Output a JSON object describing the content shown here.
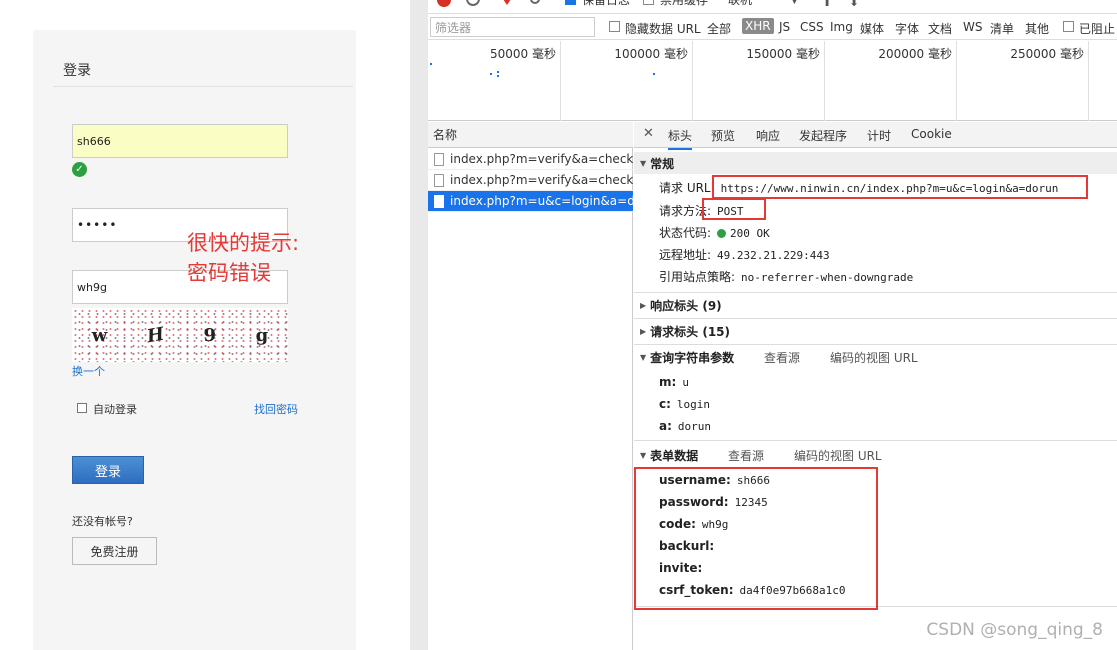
{
  "login": {
    "title": "登录",
    "username_value": "sh666",
    "password_value": "•••••",
    "captcha_value": "wh9g",
    "captcha_chars": [
      "w",
      "H",
      "9",
      "g"
    ],
    "refresh_captcha": "换一个",
    "auto_login": "自动登录",
    "find_password": "找回密码",
    "login_button": "登录",
    "no_account": "还没有帐号?",
    "register_button": "免费注册"
  },
  "annotation": "很快的提示:\n密码错误",
  "toolbar": {
    "preserve_log": "保留日志",
    "disable_cache": "禁用缓存",
    "throttle": "联机"
  },
  "filter": {
    "placeholder": "筛选器",
    "hide_data_url": "隐藏数据 URL",
    "types": [
      "全部",
      "XHR",
      "JS",
      "CSS",
      "Img",
      "媒体",
      "字体",
      "文档",
      "WS",
      "清单",
      "其他"
    ],
    "blocked": "已阻止"
  },
  "timeline": {
    "labels": [
      "50000 毫秒",
      "100000 毫秒",
      "150000 毫秒",
      "200000 毫秒",
      "250000 毫秒"
    ]
  },
  "request_list": {
    "header": "名称",
    "rows": [
      {
        "name": "index.php?m=verify&a=check...",
        "selected": false
      },
      {
        "name": "index.php?m=verify&a=check...",
        "selected": false
      },
      {
        "name": "index.php?m=u&c=login&a=d...",
        "selected": true
      }
    ]
  },
  "details": {
    "tabs": [
      "标头",
      "预览",
      "响应",
      "发起程序",
      "计时",
      "Cookie"
    ],
    "general": {
      "title": "常规",
      "request_url_key": "请求 URL:",
      "request_url": "https://www.ninwin.cn/index.php?m=u&c=login&a=dorun",
      "method_key": "请求方法:",
      "method": "POST",
      "status_key": "状态代码:",
      "status": "200 OK",
      "remote_key": "远程地址:",
      "remote": "49.232.21.229:443",
      "referrer_key": "引用站点策略:",
      "referrer": "no-referrer-when-downgrade"
    },
    "response_headers": "响应标头 (9)",
    "request_headers": "请求标头 (15)",
    "query": {
      "title": "查询字符串参数",
      "view_source": "查看源",
      "view_encoded": "编码的视图 URL",
      "params": [
        {
          "key": "m:",
          "value": "u"
        },
        {
          "key": "c:",
          "value": "login"
        },
        {
          "key": "a:",
          "value": "dorun"
        }
      ]
    },
    "form": {
      "title": "表单数据",
      "view_source": "查看源",
      "view_encoded": "编码的视图 URL",
      "params": [
        {
          "key": "username:",
          "value": "sh666"
        },
        {
          "key": "password:",
          "value": "12345"
        },
        {
          "key": "code:",
          "value": "wh9g"
        },
        {
          "key": "backurl:",
          "value": ""
        },
        {
          "key": "invite:",
          "value": ""
        },
        {
          "key": "csrf_token:",
          "value": "da4f0e97b668a1c0"
        }
      ]
    }
  },
  "watermark": "CSDN @song_qing_8"
}
